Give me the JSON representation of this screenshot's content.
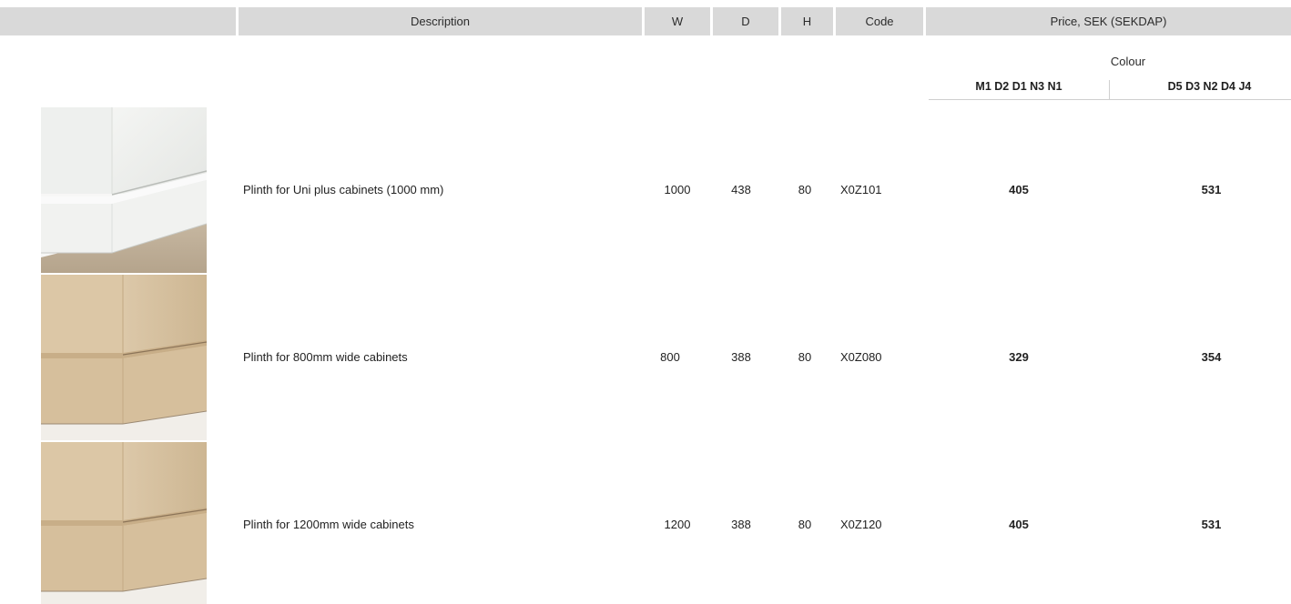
{
  "header": {
    "description": "Description",
    "w": "W",
    "d": "D",
    "h": "H",
    "code": "Code",
    "price": "Price, SEK (SEKDAP)"
  },
  "colour_label": "Colour",
  "colour_groups": [
    "M1 D2 D1 N3 N1",
    "D5 D3 N2 D4 J4"
  ],
  "rows": [
    {
      "description": "Plinth for Uni plus cabinets (1000 mm)",
      "w": "1000",
      "d": "438",
      "h": "80",
      "code": "X0Z101",
      "price_1": "405",
      "price_2": "531",
      "finish": "white"
    },
    {
      "description": "Plinth for 800mm wide cabinets",
      "w": "800",
      "d": "388",
      "h": "80",
      "code": "X0Z080",
      "price_1": "329",
      "price_2": "354",
      "finish": "birch"
    },
    {
      "description": "Plinth for 1200mm wide cabinets",
      "w": "1200",
      "d": "388",
      "h": "80",
      "code": "X0Z120",
      "price_1": "405",
      "price_2": "531",
      "finish": "birch"
    }
  ],
  "colors": {
    "header_bg": "#d9d9d9",
    "white_finish": "#eef0ee",
    "birch_finish": "#d9c3a3",
    "floor": "#b9a890"
  }
}
